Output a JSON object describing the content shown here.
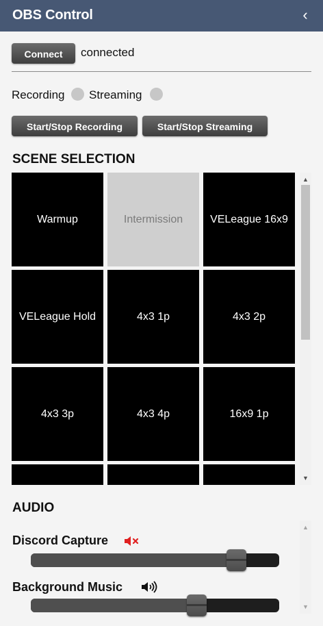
{
  "header": {
    "title": "OBS Control",
    "collapse_glyph": "‹",
    "collapse_icon": "chevron-left-icon"
  },
  "connection": {
    "button_label": "Connect",
    "status": "connected"
  },
  "indicators": {
    "recording_label": "Recording",
    "streaming_label": "Streaming",
    "recording_color": "#c7c7c7",
    "streaming_color": "#c7c7c7"
  },
  "controls": {
    "recording_button": "Start/Stop Recording",
    "streaming_button": "Start/Stop Streaming"
  },
  "scenes": {
    "title": "SCENE SELECTION",
    "items": [
      {
        "name": "Warmup",
        "active": false
      },
      {
        "name": "Intermission",
        "active": true
      },
      {
        "name": "VELeague 16x9",
        "active": false
      },
      {
        "name": "VELeague Hold",
        "active": false
      },
      {
        "name": "4x3 1p",
        "active": false
      },
      {
        "name": "4x3 2p",
        "active": false
      },
      {
        "name": "4x3 3p",
        "active": false
      },
      {
        "name": "4x3 4p",
        "active": false
      },
      {
        "name": "16x9 1p",
        "active": false
      },
      {
        "name": "",
        "active": false
      },
      {
        "name": "",
        "active": false
      },
      {
        "name": "",
        "active": false
      }
    ]
  },
  "audio": {
    "title": "AUDIO",
    "sources": [
      {
        "name": "Discord Capture",
        "muted": true,
        "icon": "speaker-muted-icon",
        "level": 0.83
      },
      {
        "name": "Background Music",
        "muted": false,
        "icon": "speaker-on-icon",
        "level": 0.67
      }
    ]
  },
  "colors": {
    "header_bg": "#475874",
    "mute_red": "#e02020",
    "active_scene": "#cfcfcf"
  }
}
